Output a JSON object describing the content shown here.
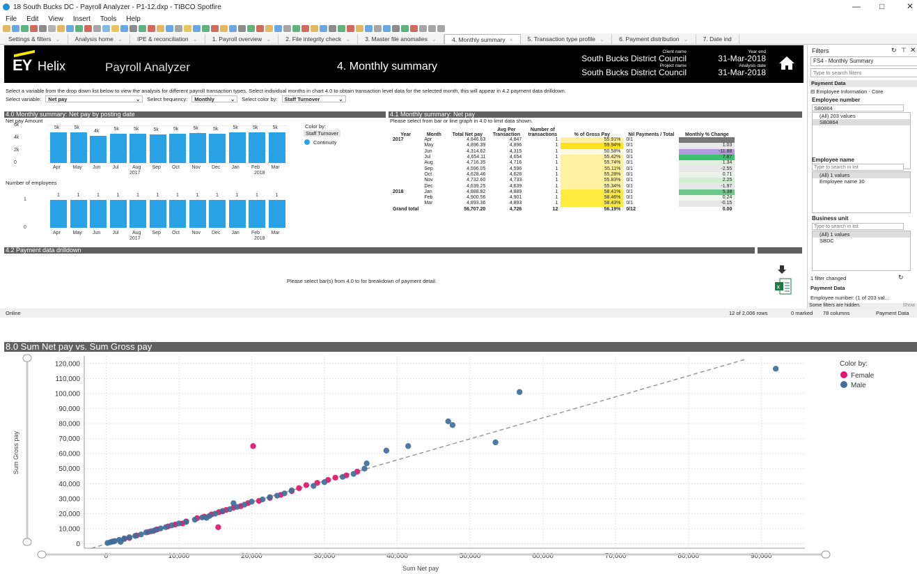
{
  "window": {
    "title": "18 South Bucks DC - Payroll Analyzer - P1-12.dxp - TIBCO Spotfire",
    "minimize": "—",
    "restore": "□",
    "close": "✕"
  },
  "menu": [
    "File",
    "Edit",
    "View",
    "Insert",
    "Tools",
    "Help"
  ],
  "tabs": [
    {
      "label": "Settings & filters",
      "active": false
    },
    {
      "label": "Analysis home",
      "active": false
    },
    {
      "label": "IPE & reconciliation",
      "active": false
    },
    {
      "label": "1. Payroll overview",
      "active": false
    },
    {
      "label": "2. File integrity check",
      "active": false
    },
    {
      "label": "3. Master file anomalies",
      "active": false
    },
    {
      "label": "4. Monthly summary",
      "active": true
    },
    {
      "label": "5. Transaction type profile",
      "active": false
    },
    {
      "label": "6. Payment distribution",
      "active": false
    },
    {
      "label": "7. Date ind",
      "active": false
    }
  ],
  "banner": {
    "brand": "EY",
    "product": "Helix",
    "app": "Payroll Analyzer",
    "page_title": "4. Monthly summary",
    "client_label": "Client name",
    "client_name": "South Bucks District Council",
    "project_label": "Project name",
    "project_name": "South Bucks District Council",
    "yearend_label": "Year end",
    "yearend": "31-Mar-2018",
    "analysis_label": "Analysis date",
    "analysis_date": "31-Mar-2018"
  },
  "instructions": "Select a variable from the drop down list below to view the analysis for different payroll transaction types. Select individual months in chart 4.0 to obtain transaction level data for the selected month, this will appear in 4.2 payment data drilldown.",
  "selectors": {
    "variable_label": "Select variable:",
    "variable": "Net pay",
    "frequency_label": "Select frequency:",
    "frequency": "Monthly",
    "color_label": "Select color by:",
    "color": "Staff Turnover"
  },
  "sec40": {
    "title": "4.0 Monthly summary: Net pay by posting date",
    "y1label": "Net pay Amount",
    "y2label": "Number of employees",
    "color_by": "Color by:",
    "color_by_value": "Staff Turnover",
    "legend": "Continuity",
    "months": [
      "Apr",
      "May",
      "Jun",
      "Jul",
      "Aug",
      "Sep",
      "Oct",
      "Nov",
      "Dec",
      "Jan",
      "Feb",
      "Mar"
    ],
    "years": [
      "2017",
      "2018"
    ],
    "net_values": [
      4846.63,
      4896.39,
      4314.62,
      4654.11,
      4716.35,
      4596.05,
      4628.46,
      4732.6,
      4639.25,
      4888.82,
      4900.56,
      4893.36
    ],
    "net_labels": [
      "5k",
      "5k",
      "4k",
      "5k",
      "5k",
      "5k",
      "5k",
      "5k",
      "5k",
      "5k",
      "5k",
      "5k"
    ],
    "y1ticks": [
      "6k",
      "4k",
      "2k",
      "0"
    ],
    "emp_values": [
      1,
      1,
      1,
      1,
      1,
      1,
      1,
      1,
      1,
      1,
      1,
      1
    ],
    "y2ticks": [
      "1",
      "0"
    ]
  },
  "sec41": {
    "title": "4.1 Monthly summary: Net pay",
    "subtitle": "Please select from bar or line graph in 4.0 to limit data shown.",
    "headers": [
      "Year",
      "Month",
      "Total Net pay",
      "Avg Per Transaction",
      "Number of transactions",
      "% of Gross Pay",
      "Nil Payments / Total",
      "Monthly % Change"
    ],
    "rows": [
      [
        "2017",
        "Apr",
        "4,846.63",
        "4,847",
        "1",
        "55.91%",
        "0/1",
        ""
      ],
      [
        "",
        "May",
        "4,896.39",
        "4,896",
        "1",
        "59.94%",
        "0/1",
        "1.03"
      ],
      [
        "",
        "Jun",
        "4,314.62",
        "4,315",
        "1",
        "50.58%",
        "0/1",
        "-11.88"
      ],
      [
        "",
        "Jul",
        "4,654.11",
        "4,654",
        "1",
        "55.42%",
        "0/1",
        "7.87"
      ],
      [
        "",
        "Aug",
        "4,716.35",
        "4,716",
        "1",
        "55.74%",
        "0/1",
        "1.34"
      ],
      [
        "",
        "Sep",
        "4,596.05",
        "4,596",
        "1",
        "55.11%",
        "0/1",
        "-2.55"
      ],
      [
        "",
        "Oct",
        "4,628.46",
        "4,628",
        "1",
        "55.28%",
        "0/1",
        "0.71"
      ],
      [
        "",
        "Nov",
        "4,732.60",
        "4,733",
        "1",
        "55.83%",
        "0/1",
        "2.25"
      ],
      [
        "",
        "Dec",
        "4,639.25",
        "4,639",
        "1",
        "55.34%",
        "0/1",
        "-1.97"
      ],
      [
        "2018",
        "Jan",
        "4,888.82",
        "4,889",
        "1",
        "58.41%",
        "0/1",
        "5.38"
      ],
      [
        "",
        "Feb",
        "4,900.56",
        "4,901",
        "1",
        "58.46%",
        "0/1",
        "0.24"
      ],
      [
        "",
        "Mar",
        "4,893.36",
        "4,893",
        "1",
        "58.43%",
        "0/1",
        "-0.15"
      ]
    ],
    "total": [
      "Grand total",
      "",
      "56,707.20",
      "4,726",
      "12",
      "56.19%",
      "0/12",
      "0.00"
    ],
    "change_colors": [
      "#777777",
      "#e8e8e8",
      "#b49be0",
      "#3cc070",
      "#e0f0e0",
      "#e8e8e8",
      "#e8f4e8",
      "#d4ecd4",
      "#e8e8e8",
      "#6cc88a",
      "#eef6ee",
      "#e8e8e8"
    ]
  },
  "sec42": {
    "title": "4.2 Payment data drilldown",
    "message": "Please select bar(s) from 4.0 to for breakdown of payment detail."
  },
  "filters": {
    "title": "Filters",
    "scheme": "FS4 - Monthly Summary",
    "search_placeholder": "Type to search filters",
    "table": "Payment Data",
    "group": "Employee Information - Core",
    "emp_no_label": "Employee number",
    "emp_no_value": "SB0864",
    "emp_no_all": "(All) 203 values",
    "emp_no_item": "SB0864",
    "emp_name_label": "Employee name",
    "emp_name_placeholder": "Type to search in list",
    "emp_name_all": "(All) 1 values",
    "emp_name_item": "Employee name 30",
    "bu_label": "Business unit",
    "bu_placeholder": "Type to search in list",
    "bu_all": "(All) 1 values",
    "bu_item": "SBDC",
    "changed": "1 filter changed",
    "pd_label": "Payment Data",
    "pd_value": "Employee number: (1 of 203 val...",
    "hidden": "Some filters are hidden.",
    "show": "Show"
  },
  "status": {
    "state": "Online",
    "rows": "12 of 2,006 rows",
    "marked": "0 marked",
    "columns": "78 columns",
    "table": "Payment Data"
  },
  "scatter": {
    "title": "8.0 Sum Net pay vs. Sum Gross pay",
    "xlabel": "Sum Net pay",
    "ylabel": "Sum Gross pay",
    "color_by": "Color by:",
    "legend": [
      {
        "name": "Female",
        "color": "#e0176a"
      },
      {
        "name": "Male",
        "color": "#3f6f9a"
      }
    ],
    "xticks": [
      "0",
      "10,000",
      "20,000",
      "30,000",
      "40,000",
      "50,000",
      "60,000",
      "70,000",
      "80,000",
      "90,000"
    ],
    "yticks": [
      "120,000",
      "110,000",
      "100,000",
      "90,000",
      "80,000",
      "70,000",
      "60,000",
      "50,000",
      "40,000",
      "30,000",
      "20,000",
      "10,000",
      "0"
    ]
  },
  "chart_data": {
    "type": "scatter",
    "title": "8.0 Sum Net pay vs. Sum Gross pay",
    "xlabel": "Sum Net pay",
    "ylabel": "Sum Gross pay",
    "xlim": [
      -3000,
      96000
    ],
    "ylim": [
      -3000,
      125000
    ],
    "grid": true,
    "legend_position": "top-right",
    "trend_line": [
      [
        -2000,
        -3000
      ],
      [
        88000,
        123000
      ]
    ],
    "series": [
      {
        "name": "Female",
        "color": "#e0176a",
        "points": [
          [
            1000,
            1500
          ],
          [
            2500,
            3200
          ],
          [
            4200,
            5500
          ],
          [
            5800,
            7800
          ],
          [
            7000,
            9500
          ],
          [
            8500,
            11500
          ],
          [
            9500,
            12800
          ],
          [
            11000,
            14800
          ],
          [
            12500,
            17000
          ],
          [
            13500,
            18000
          ],
          [
            14500,
            19500
          ],
          [
            15500,
            21000
          ],
          [
            16500,
            22500
          ],
          [
            17500,
            24000
          ],
          [
            18500,
            25000
          ],
          [
            19500,
            27000
          ],
          [
            20200,
            65000
          ],
          [
            21000,
            28500
          ],
          [
            22500,
            30500
          ],
          [
            24000,
            32500
          ],
          [
            25500,
            35000
          ],
          [
            26500,
            37000
          ],
          [
            27500,
            39000
          ],
          [
            29000,
            40500
          ],
          [
            30500,
            42500
          ],
          [
            31500,
            44000
          ],
          [
            33000,
            45500
          ],
          [
            34500,
            48000
          ],
          [
            15400,
            11000
          ],
          [
            3200,
            3800
          ],
          [
            6500,
            8500
          ],
          [
            10500,
            13500
          ],
          [
            16000,
            21500
          ]
        ]
      },
      {
        "name": "Male",
        "color": "#3f6f9a",
        "points": [
          [
            200,
            500
          ],
          [
            600,
            1000
          ],
          [
            1200,
            1800
          ],
          [
            1800,
            2600
          ],
          [
            2500,
            3500
          ],
          [
            3200,
            4300
          ],
          [
            4000,
            5200
          ],
          [
            4800,
            6200
          ],
          [
            5500,
            7500
          ],
          [
            6200,
            8300
          ],
          [
            6800,
            9200
          ],
          [
            7500,
            10200
          ],
          [
            8200,
            11000
          ],
          [
            9000,
            12200
          ],
          [
            10000,
            13500
          ],
          [
            11000,
            14500
          ],
          [
            12200,
            16000
          ],
          [
            13200,
            17500
          ],
          [
            14200,
            18500
          ],
          [
            15000,
            20000
          ],
          [
            16000,
            21800
          ],
          [
            17000,
            23000
          ],
          [
            17500,
            27000
          ],
          [
            18000,
            24500
          ],
          [
            19000,
            26000
          ],
          [
            20000,
            28000
          ],
          [
            21500,
            29500
          ],
          [
            22500,
            31000
          ],
          [
            23500,
            32000
          ],
          [
            24500,
            33500
          ],
          [
            25500,
            35500
          ],
          [
            28500,
            38500
          ],
          [
            30000,
            41000
          ],
          [
            32500,
            44500
          ],
          [
            34000,
            46500
          ],
          [
            35500,
            50000
          ],
          [
            35800,
            53500
          ],
          [
            38500,
            62000
          ],
          [
            41500,
            65000
          ],
          [
            47000,
            81500
          ],
          [
            47600,
            79000
          ],
          [
            53500,
            67500
          ],
          [
            56800,
            101000
          ],
          [
            92000,
            116500
          ],
          [
            900,
            1500
          ],
          [
            2000,
            1200
          ],
          [
            13800,
            17200
          ]
        ]
      }
    ]
  }
}
